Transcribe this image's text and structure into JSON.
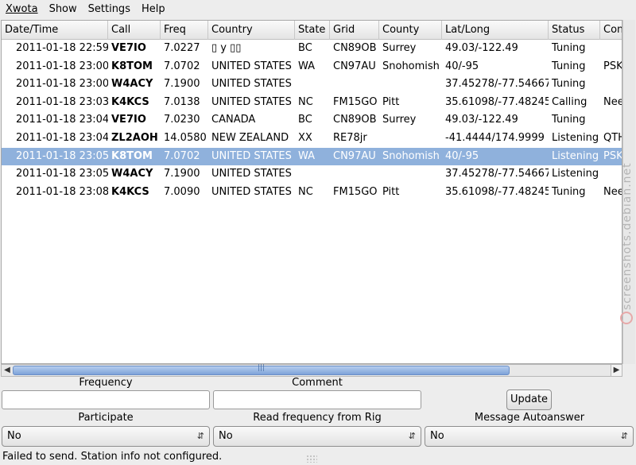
{
  "menu": [
    "Xwota",
    "Show",
    "Settings",
    "Help"
  ],
  "columns": [
    "Date/Time",
    "Call",
    "Freq",
    "Country",
    "State",
    "Grid",
    "County",
    "Lat/Long",
    "Status",
    "Comment"
  ],
  "rows": [
    {
      "datetime": "2011-01-18 22:59",
      "call": "VE7IO",
      "freq": "7.0227",
      "country": "▯ y ▯▯",
      "state": "BC",
      "grid": "CN89OB",
      "county": "Surrey",
      "latlong": "49.03/-122.49",
      "status": "Tuning",
      "comment": ""
    },
    {
      "datetime": "2011-01-18 23:00",
      "call": "K8TOM",
      "freq": "7.0702",
      "country": "UNITED STATES",
      "state": "WA",
      "grid": "CN97AU",
      "county": "Snohomish",
      "latlong": "40/-95",
      "status": "Tuning",
      "comment": "PSK"
    },
    {
      "datetime": "2011-01-18 23:00",
      "call": "W4ACY",
      "freq": "7.1900",
      "country": "UNITED STATES",
      "state": "",
      "grid": "",
      "county": "",
      "latlong": "37.45278/-77.54667",
      "status": "Tuning",
      "comment": ""
    },
    {
      "datetime": "2011-01-18 23:03",
      "call": "K4KCS",
      "freq": "7.0138",
      "country": "UNITED STATES",
      "state": "NC",
      "grid": "FM15GO",
      "county": "Pitt",
      "latlong": "35.61098/-77.48245",
      "status": "Calling",
      "comment": "Nee"
    },
    {
      "datetime": "2011-01-18 23:04",
      "call": "VE7IO",
      "freq": "7.0230",
      "country": "CANADA",
      "state": "BC",
      "grid": "CN89OB",
      "county": "Surrey",
      "latlong": "49.03/-122.49",
      "status": "Tuning",
      "comment": ""
    },
    {
      "datetime": "2011-01-18 23:04",
      "call": "ZL2AOH",
      "freq": "14.0580",
      "country": "NEW ZEALAND",
      "state": "XX",
      "grid": "RE78jr",
      "county": "",
      "latlong": "-41.4444/174.9999",
      "status": "Listening",
      "comment": "QTH"
    },
    {
      "datetime": "2011-01-18 23:05",
      "call": "K8TOM",
      "freq": "7.0702",
      "country": "UNITED STATES",
      "state": "WA",
      "grid": "CN97AU",
      "county": "Snohomish",
      "latlong": "40/-95",
      "status": "Listening",
      "comment": "PSK",
      "selected": true
    },
    {
      "datetime": "2011-01-18 23:05",
      "call": "W4ACY",
      "freq": "7.1900",
      "country": "UNITED STATES",
      "state": "",
      "grid": "",
      "county": "",
      "latlong": "37.45278/-77.54667",
      "status": "Listening",
      "comment": ""
    },
    {
      "datetime": "2011-01-18 23:08",
      "call": "K4KCS",
      "freq": "7.0090",
      "country": "UNITED STATES",
      "state": "NC",
      "grid": "FM15GO",
      "county": "Pitt",
      "latlong": "35.61098/-77.48245",
      "status": "Tuning",
      "comment": "Nee"
    }
  ],
  "form": {
    "frequency_label": "Frequency",
    "frequency_value": "",
    "comment_label": "Comment",
    "comment_value": "",
    "update_button": "Update",
    "participate_label": "Participate",
    "participate_value": "No",
    "read_freq_label": "Read frequency from Rig",
    "read_freq_value": "No",
    "autoanswer_label": "Message Autoanswer",
    "autoanswer_value": "No"
  },
  "watermark": "screenshots.debian.net",
  "status_text": "Failed to send. Station info not configured.",
  "colors": {
    "selection": "#8fb1dc",
    "scroll_thumb": "#7ea3d9"
  }
}
